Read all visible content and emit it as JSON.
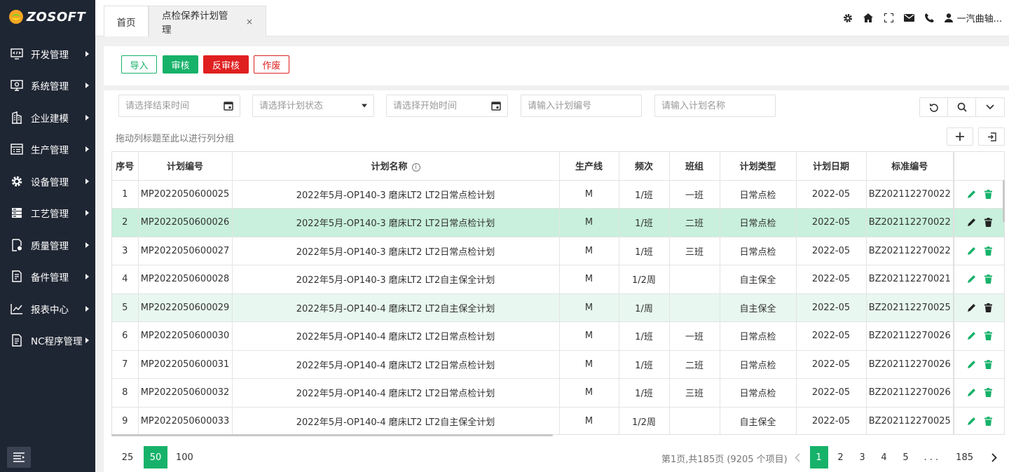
{
  "brand": {
    "logo_text": "ZOSOFT",
    "accent": "#17b26a",
    "sidebar_bg": "#1f2633"
  },
  "sidebar": {
    "items": [
      {
        "label": "开发管理",
        "icon": "code-window-icon"
      },
      {
        "label": "系统管理",
        "icon": "monitor-settings-icon"
      },
      {
        "label": "企业建模",
        "icon": "building-icon"
      },
      {
        "label": "生产管理",
        "icon": "production-list-icon"
      },
      {
        "label": "设备管理",
        "icon": "gear-icon"
      },
      {
        "label": "工艺管理",
        "icon": "layers-icon"
      },
      {
        "label": "质量管理",
        "icon": "quality-doc-icon"
      },
      {
        "label": "备件管理",
        "icon": "edit-doc-icon"
      },
      {
        "label": "报表中心",
        "icon": "line-chart-icon"
      },
      {
        "label": "NC程序管理",
        "icon": "nc-doc-icon"
      }
    ]
  },
  "tabs": {
    "home": "首页",
    "active": "点检保养计划管理",
    "close": "×"
  },
  "header": {
    "user": "一汽曲轴..."
  },
  "toolbar": {
    "import": "导入",
    "approve": "审核",
    "unapprove": "反审核",
    "void": "作废"
  },
  "filters": {
    "end_time": "请选择结束时间",
    "status": "请选择计划状态",
    "start_time": "请选择开始时间",
    "plan_code": "请输入计划编号",
    "plan_name": "请输入计划名称"
  },
  "group_hint": "拖动列标题至此以进行列分组",
  "table": {
    "headers": {
      "no": "序号",
      "code": "计划编号",
      "name": "计划名称",
      "line": "生产线",
      "freq": "频次",
      "team": "班组",
      "type": "计划类型",
      "date": "计划日期",
      "std": "标准编号"
    },
    "rows": [
      {
        "no": "1",
        "code": "MP2022050600025",
        "name": "2022年5月-OP140-3 磨床LT2 LT2日常点检计划",
        "line": "M",
        "freq": "1/班",
        "team": "一班",
        "type": "日常点检",
        "date": "2022-05",
        "std": "BZ202112270022"
      },
      {
        "no": "2",
        "code": "MP2022050600026",
        "name": "2022年5月-OP140-3 磨床LT2 LT2日常点检计划",
        "line": "M",
        "freq": "1/班",
        "team": "二班",
        "type": "日常点检",
        "date": "2022-05",
        "std": "BZ202112270022"
      },
      {
        "no": "3",
        "code": "MP2022050600027",
        "name": "2022年5月-OP140-3 磨床LT2 LT2日常点检计划",
        "line": "M",
        "freq": "1/班",
        "team": "三班",
        "type": "日常点检",
        "date": "2022-05",
        "std": "BZ202112270022"
      },
      {
        "no": "4",
        "code": "MP2022050600028",
        "name": "2022年5月-OP140-3 磨床LT2 LT2自主保全计划",
        "line": "M",
        "freq": "1/2周",
        "team": "",
        "type": "自主保全",
        "date": "2022-05",
        "std": "BZ202112270021"
      },
      {
        "no": "5",
        "code": "MP2022050600029",
        "name": "2022年5月-OP140-4 磨床LT2 LT2自主保全计划",
        "line": "M",
        "freq": "1/周",
        "team": "",
        "type": "自主保全",
        "date": "2022-05",
        "std": "BZ202112270025"
      },
      {
        "no": "6",
        "code": "MP2022050600030",
        "name": "2022年5月-OP140-4 磨床LT2 LT2日常点检计划",
        "line": "M",
        "freq": "1/班",
        "team": "一班",
        "type": "日常点检",
        "date": "2022-05",
        "std": "BZ202112270026"
      },
      {
        "no": "7",
        "code": "MP2022050600031",
        "name": "2022年5月-OP140-4 磨床LT2 LT2日常点检计划",
        "line": "M",
        "freq": "1/班",
        "team": "二班",
        "type": "日常点检",
        "date": "2022-05",
        "std": "BZ202112270026"
      },
      {
        "no": "8",
        "code": "MP2022050600032",
        "name": "2022年5月-OP140-4 磨床LT2 LT2日常点检计划",
        "line": "M",
        "freq": "1/班",
        "team": "三班",
        "type": "日常点检",
        "date": "2022-05",
        "std": "BZ202112270026"
      },
      {
        "no": "9",
        "code": "MP2022050600033",
        "name": "2022年5月-OP140-4 磨床LT2 LT2自主保全计划",
        "line": "M",
        "freq": "1/2周",
        "team": "",
        "type": "自主保全",
        "date": "2022-05",
        "std": "BZ202112270025"
      }
    ]
  },
  "pager": {
    "sizes": [
      "25",
      "50",
      "100"
    ],
    "active_size": "50",
    "info": "第1页,共185页 (9205 个项目)",
    "pages": [
      "1",
      "2",
      "3",
      "4",
      "5",
      ". . .",
      "185"
    ],
    "active_page": "1"
  }
}
